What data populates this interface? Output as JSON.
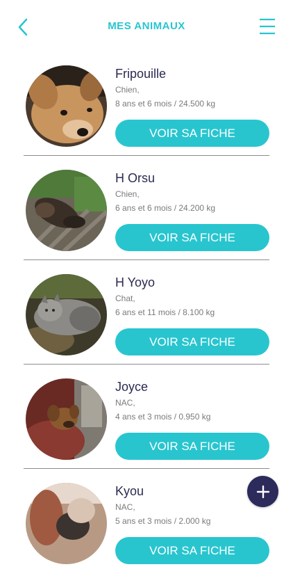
{
  "header": {
    "title": "MES ANIMAUX",
    "back_icon": "chevron-left-icon",
    "menu_icon": "hamburger-menu-icon",
    "accent_color": "#28c5cf"
  },
  "animals": [
    {
      "name": "Fripouille",
      "species": "Chien,",
      "age_weight": "8 ans et 6 mois / 24.500 kg",
      "button": "VOIR SA FICHE"
    },
    {
      "name": "H Orsu",
      "species": "Chien,",
      "age_weight": "6 ans et 6 mois / 24.200 kg",
      "button": "VOIR SA FICHE"
    },
    {
      "name": "H Yoyo",
      "species": "Chat,",
      "age_weight": "6 ans et 11 mois / 8.100 kg",
      "button": "VOIR SA FICHE"
    },
    {
      "name": "Joyce",
      "species": "NAC,",
      "age_weight": "4 ans et 3 mois / 0.950 kg",
      "button": "VOIR SA FICHE"
    },
    {
      "name": "Kyou",
      "species": "NAC,",
      "age_weight": "5 ans et 3 mois / 2.000 kg",
      "button": "VOIR SA FICHE"
    }
  ],
  "fab": {
    "icon": "plus-icon",
    "color": "#2d2a5c"
  }
}
